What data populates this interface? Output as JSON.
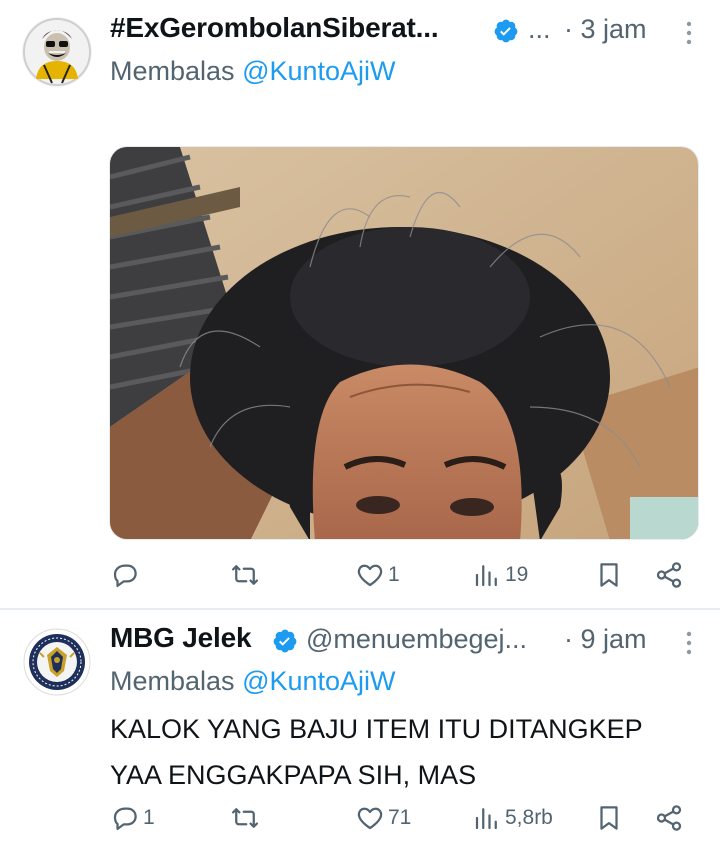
{
  "tweets": [
    {
      "display_name": "#ExGerombolanSiberat...",
      "handle": "...",
      "separator": "·",
      "time": "3 jam",
      "reply_prefix": "Membalas",
      "reply_mention": "@KuntoAjiW",
      "body": [],
      "has_media": true,
      "actions": {
        "replies": "",
        "retweets": "",
        "likes": "1",
        "views": "19"
      }
    },
    {
      "display_name": "MBG Jelek",
      "handle": "@menuembegej...",
      "separator": "·",
      "time": "9 jam",
      "reply_prefix": "Membalas",
      "reply_mention": "@KuntoAjiW",
      "body": [
        "KALOK YANG BAJU ITEM ITU DITANGKEP",
        "YAA ENGGAKPAPA SIH, MAS"
      ],
      "has_media": false,
      "actions": {
        "replies": "1",
        "retweets": "",
        "likes": "71",
        "views": "5,8rb"
      }
    }
  ],
  "icons": {
    "reply": "reply-icon",
    "retweet": "retweet-icon",
    "like": "heart-icon",
    "views": "views-icon",
    "bookmark": "bookmark-icon",
    "share": "share-icon",
    "verified": "verified-badge-icon",
    "more": "more-icon"
  },
  "colors": {
    "accent": "#1d9bf0",
    "text": "#0f1419",
    "muted": "#536471"
  }
}
